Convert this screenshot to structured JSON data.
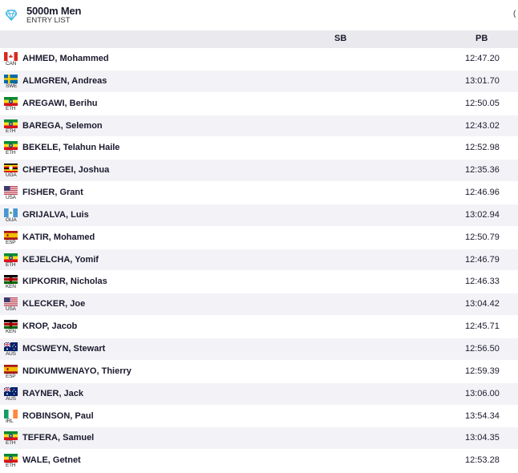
{
  "event": {
    "title": "5000m Men",
    "subtitle": "ENTRY LIST",
    "edge_glyph": "("
  },
  "columns": {
    "sb": "SB",
    "pb": "PB"
  },
  "entries": [
    {
      "country": "CAN",
      "name": "AHMED, Mohammed",
      "sb": "",
      "pb": "12:47.20"
    },
    {
      "country": "SWE",
      "name": "ALMGREN, Andreas",
      "sb": "",
      "pb": "13:01.70"
    },
    {
      "country": "ETH",
      "name": "AREGAWI, Berihu",
      "sb": "",
      "pb": "12:50.05"
    },
    {
      "country": "ETH",
      "name": "BAREGA, Selemon",
      "sb": "",
      "pb": "12:43.02"
    },
    {
      "country": "ETH",
      "name": "BEKELE, Telahun Haile",
      "sb": "",
      "pb": "12:52.98"
    },
    {
      "country": "UGA",
      "name": "CHEPTEGEI, Joshua",
      "sb": "",
      "pb": "12:35.36"
    },
    {
      "country": "USA",
      "name": "FISHER, Grant",
      "sb": "",
      "pb": "12:46.96"
    },
    {
      "country": "GUA",
      "name": "GRIJALVA, Luis",
      "sb": "",
      "pb": "13:02.94"
    },
    {
      "country": "ESP",
      "name": "KATIR, Mohamed",
      "sb": "",
      "pb": "12:50.79"
    },
    {
      "country": "ETH",
      "name": "KEJELCHA, Yomif",
      "sb": "",
      "pb": "12:46.79"
    },
    {
      "country": "KEN",
      "name": "KIPKORIR, Nicholas",
      "sb": "",
      "pb": "12:46.33"
    },
    {
      "country": "USA",
      "name": "KLECKER, Joe",
      "sb": "",
      "pb": "13:04.42"
    },
    {
      "country": "KEN",
      "name": "KROP, Jacob",
      "sb": "",
      "pb": "12:45.71"
    },
    {
      "country": "AUS",
      "name": "MCSWEYN, Stewart",
      "sb": "",
      "pb": "12:56.50"
    },
    {
      "country": "ESP",
      "name": "NDIKUMWENAYO, Thierry",
      "sb": "",
      "pb": "12:59.39"
    },
    {
      "country": "AUS",
      "name": "RAYNER, Jack",
      "sb": "",
      "pb": "13:06.00"
    },
    {
      "country": "IRL",
      "name": "ROBINSON, Paul",
      "sb": "",
      "pb": "13:54.34"
    },
    {
      "country": "ETH",
      "name": "TEFERA, Samuel",
      "sb": "",
      "pb": "13:04.35"
    },
    {
      "country": "ETH",
      "name": "WALE, Getnet",
      "sb": "",
      "pb": "12:53.28"
    }
  ],
  "icons": {
    "header": "diamond-league-icon"
  }
}
